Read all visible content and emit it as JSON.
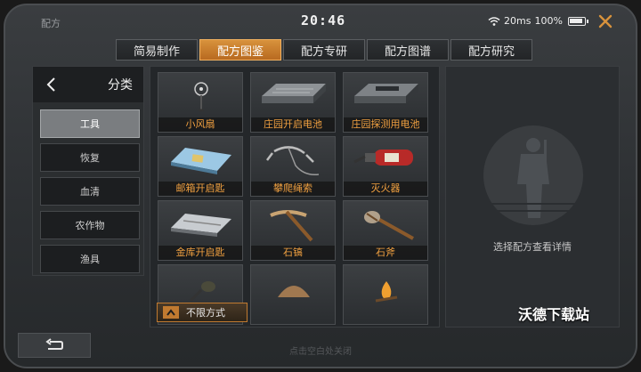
{
  "status": {
    "app_name": "配方",
    "time": "20:46",
    "signal": "20ms",
    "battery": "100%"
  },
  "tabs": [
    {
      "label": "简易制作",
      "active": false
    },
    {
      "label": "配方图鉴",
      "active": true
    },
    {
      "label": "配方专研",
      "active": false
    },
    {
      "label": "配方图谱",
      "active": false
    },
    {
      "label": "配方研究",
      "active": false
    }
  ],
  "sidebar": {
    "title": "分类",
    "items": [
      {
        "label": "工具",
        "active": true
      },
      {
        "label": "恢复",
        "active": false
      },
      {
        "label": "血清",
        "active": false
      },
      {
        "label": "农作物",
        "active": false
      },
      {
        "label": "渔具",
        "active": false
      }
    ]
  },
  "recipes": [
    {
      "label": "小风扇",
      "icon": "fan-icon"
    },
    {
      "label": "庄园开启电池",
      "icon": "battery-pack-icon"
    },
    {
      "label": "庄园探测用电池",
      "icon": "battery-pack-icon"
    },
    {
      "label": "邮箱开启匙",
      "icon": "keycard-icon"
    },
    {
      "label": "攀爬绳索",
      "icon": "grappling-hook-icon"
    },
    {
      "label": "灭火器",
      "icon": "fire-extinguisher-icon"
    },
    {
      "label": "金库开启匙",
      "icon": "vault-card-icon"
    },
    {
      "label": "石镐",
      "icon": "pickaxe-icon"
    },
    {
      "label": "石斧",
      "icon": "axe-icon"
    },
    {
      "label": "",
      "icon": "frying-pan-icon"
    },
    {
      "label": "",
      "icon": "basket-icon"
    },
    {
      "label": "",
      "icon": "campfire-icon"
    }
  ],
  "filter": {
    "label": "不限方式"
  },
  "detail": {
    "hint": "选择配方查看详情"
  },
  "watermark": "沃德下载站",
  "bottom_hint": "点击空白处关闭",
  "colors": {
    "accent": "#d8923c",
    "label": "#f0a040"
  }
}
